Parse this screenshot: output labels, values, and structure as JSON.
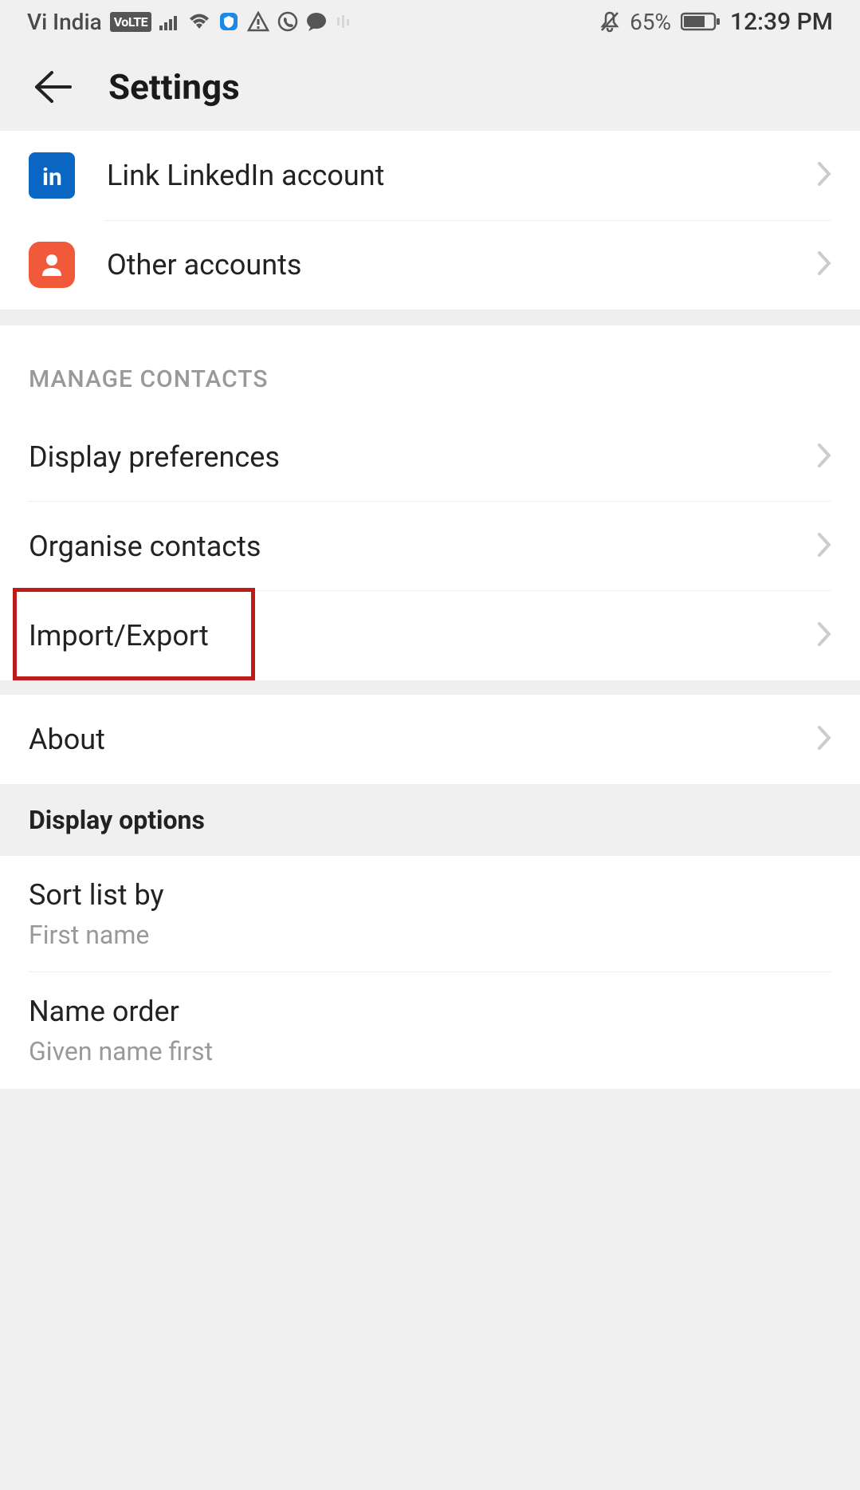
{
  "status_bar": {
    "carrier": "Vi India",
    "volte": "VoLTE",
    "battery_pct": "65%",
    "time": "12:39 PM"
  },
  "header": {
    "title": "Settings"
  },
  "accounts": {
    "linkedin": "Link LinkedIn account",
    "other": "Other accounts"
  },
  "manage_contacts": {
    "header": "MANAGE CONTACTS",
    "display_preferences": "Display preferences",
    "organise_contacts": "Organise contacts",
    "import_export": "Import/Export"
  },
  "about": "About",
  "display_options": {
    "header": "Display options",
    "sort_title": "Sort list by",
    "sort_value": "First name",
    "name_order_title": "Name order",
    "name_order_value": "Given name first"
  }
}
